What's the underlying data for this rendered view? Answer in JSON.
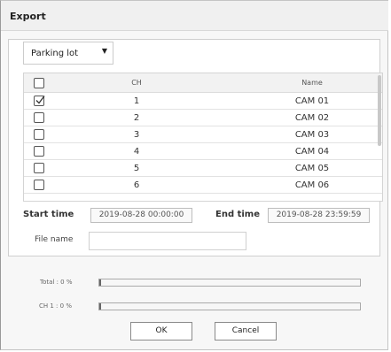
{
  "dialog": {
    "title": "Export"
  },
  "location": {
    "selected": "Parking lot",
    "caret": "▼"
  },
  "table": {
    "headers": {
      "ch": "CH",
      "name": "Name"
    },
    "rows": [
      {
        "ch": "1",
        "name": "CAM 01",
        "checked": true
      },
      {
        "ch": "2",
        "name": "CAM 02",
        "checked": false
      },
      {
        "ch": "3",
        "name": "CAM 03",
        "checked": false
      },
      {
        "ch": "4",
        "name": "CAM 04",
        "checked": false
      },
      {
        "ch": "5",
        "name": "CAM 05",
        "checked": false
      },
      {
        "ch": "6",
        "name": "CAM 06",
        "checked": false
      }
    ]
  },
  "time": {
    "start_label": "Start time",
    "start_value": "2019-08-28 00:00:00",
    "end_label": "End time",
    "end_value": "2019-08-28 23:59:59"
  },
  "file": {
    "label": "File name",
    "value": ""
  },
  "progress": {
    "total_label": "Total : 0 %",
    "total_value": 0,
    "ch_label": "CH 1 : 0 %",
    "ch_value": 0
  },
  "buttons": {
    "ok": "OK",
    "cancel": "Cancel"
  }
}
